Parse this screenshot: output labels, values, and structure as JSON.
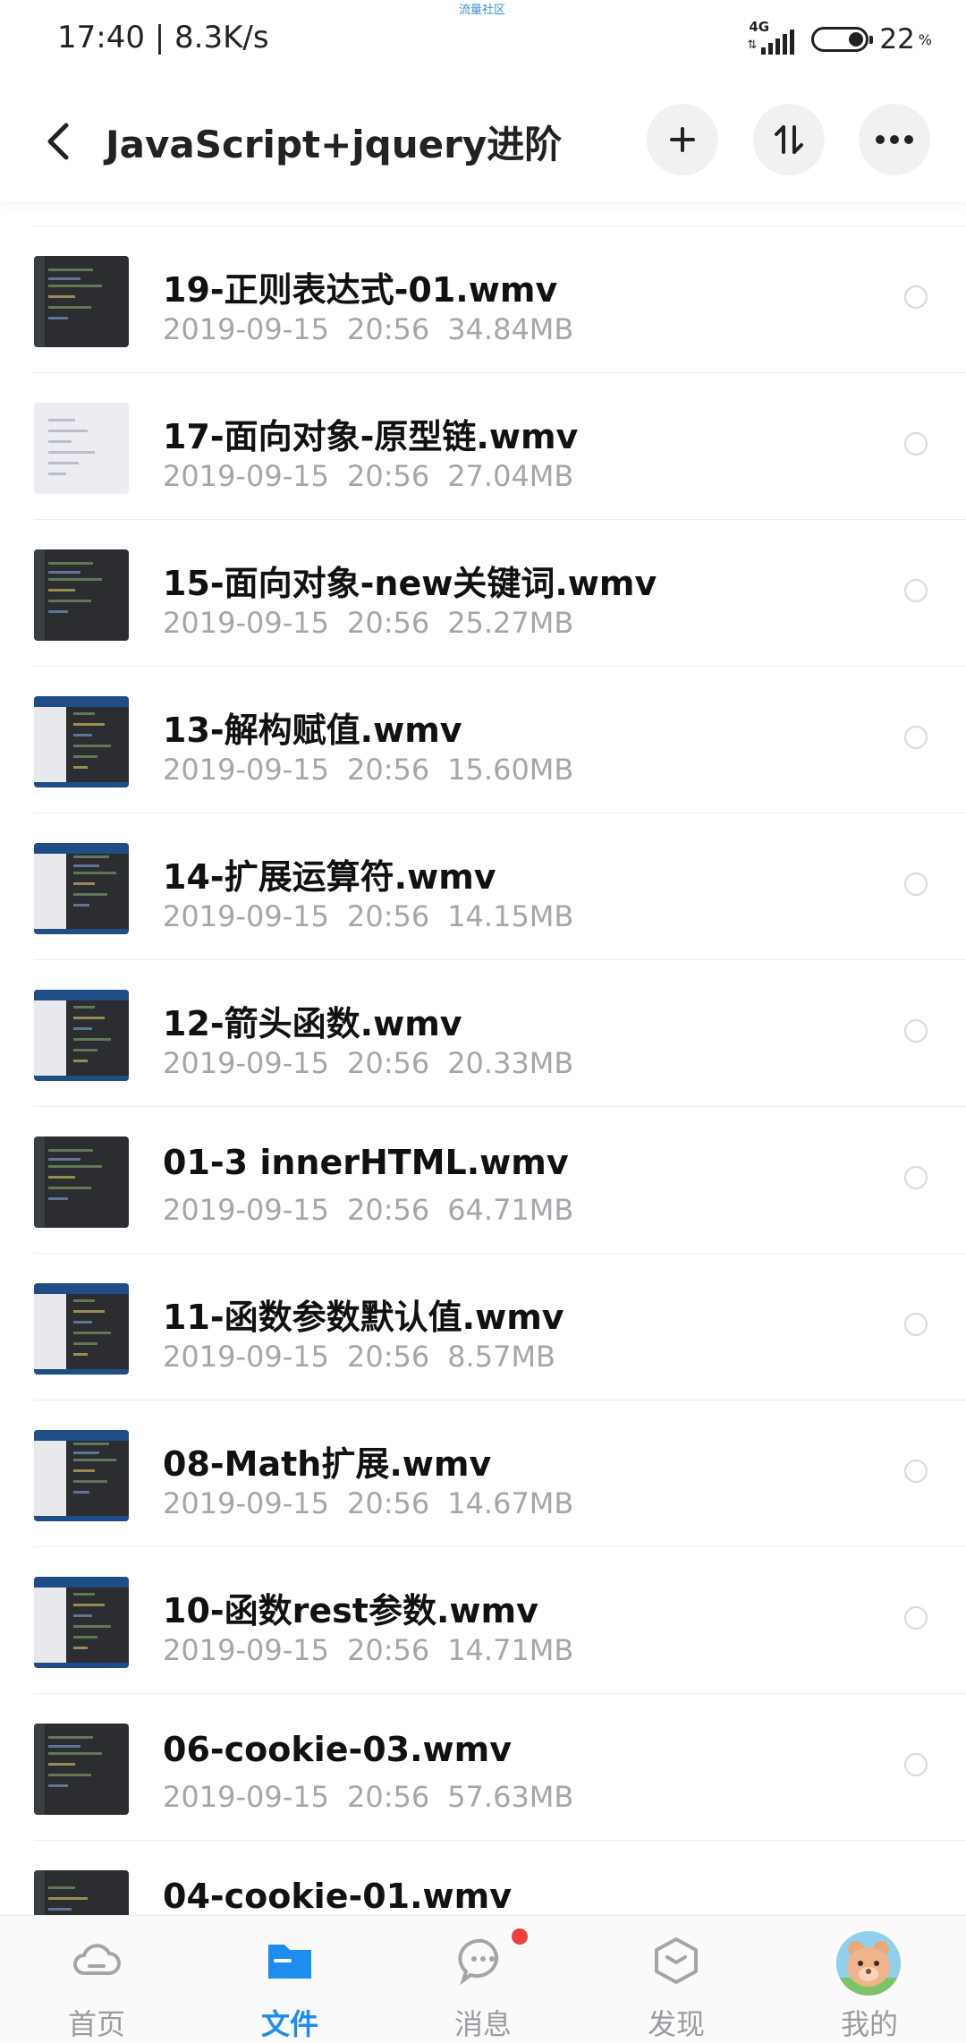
{
  "status": {
    "time_speed": "17:40 | 8.3K/s",
    "tiny_label": "流量社区",
    "network": "4G",
    "battery": "22",
    "battery_unit": "%"
  },
  "header": {
    "title": "JavaScript+jquery进阶",
    "icons": [
      "back-arrow-icon",
      "plus-icon",
      "sort-icon",
      "more-icon"
    ]
  },
  "files": [
    {
      "name": "19-正则表达式-01.wmv",
      "date": "2019-09-15",
      "time": "20:56",
      "size": "34.84MB",
      "thumb": "dark"
    },
    {
      "name": "17-面向对象-原型链.wmv",
      "date": "2019-09-15",
      "time": "20:56",
      "size": "27.04MB",
      "thumb": "light"
    },
    {
      "name": "15-面向对象-new关键词.wmv",
      "date": "2019-09-15",
      "time": "20:56",
      "size": "25.27MB",
      "thumb": "dark"
    },
    {
      "name": "13-解构赋值.wmv",
      "date": "2019-09-15",
      "time": "20:56",
      "size": "15.60MB",
      "thumb": "win"
    },
    {
      "name": "14-扩展运算符.wmv",
      "date": "2019-09-15",
      "time": "20:56",
      "size": "14.15MB",
      "thumb": "win"
    },
    {
      "name": "12-箭头函数.wmv",
      "date": "2019-09-15",
      "time": "20:56",
      "size": "20.33MB",
      "thumb": "win"
    },
    {
      "name": "01-3 innerHTML.wmv",
      "date": "2019-09-15",
      "time": "20:56",
      "size": "64.71MB",
      "thumb": "dark"
    },
    {
      "name": "11-函数参数默认值.wmv",
      "date": "2019-09-15",
      "time": "20:56",
      "size": "8.57MB",
      "thumb": "win"
    },
    {
      "name": "08-Math扩展.wmv",
      "date": "2019-09-15",
      "time": "20:56",
      "size": "14.67MB",
      "thumb": "win"
    },
    {
      "name": "10-函数rest参数.wmv",
      "date": "2019-09-15",
      "time": "20:56",
      "size": "14.71MB",
      "thumb": "win"
    },
    {
      "name": "06-cookie-03.wmv",
      "date": "2019-09-15",
      "time": "20:56",
      "size": "57.63MB",
      "thumb": "dark"
    },
    {
      "name": "04-cookie-01.wmv",
      "date": "",
      "time": "",
      "size": "",
      "thumb": "dark"
    }
  ],
  "nav": {
    "tabs": [
      {
        "label": "首页",
        "icon": "cloud-icon",
        "active": false
      },
      {
        "label": "文件",
        "icon": "folder-icon",
        "active": true
      },
      {
        "label": "消息",
        "icon": "chat-icon",
        "active": false
      },
      {
        "label": "发现",
        "icon": "cube-icon",
        "active": false
      },
      {
        "label": "我的",
        "icon": "avatar-icon",
        "active": false
      }
    ],
    "accent": "#1d8ef0",
    "badge_color": "#f0403c"
  }
}
